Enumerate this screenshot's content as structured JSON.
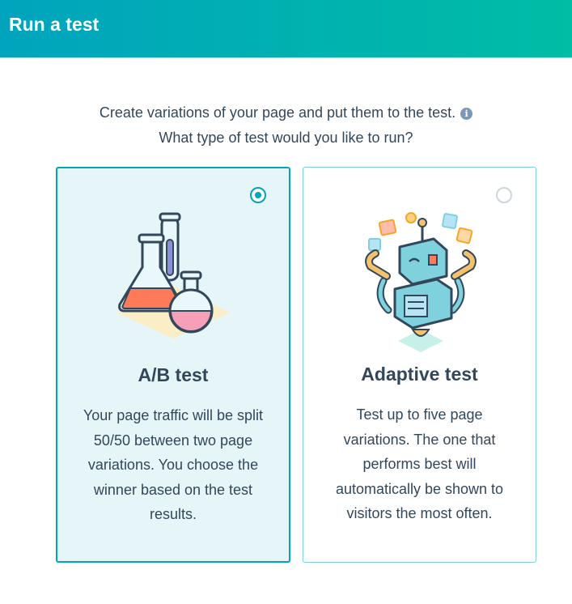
{
  "header": {
    "title": "Run a test"
  },
  "intro": {
    "line1": "Create variations of your page and put them to the test.",
    "line2": "What type of test would you like to run?",
    "info_icon": "info-icon"
  },
  "options": [
    {
      "title": "A/B test",
      "description": "Your page traffic will be split 50/50 between two page variations. You choose the winner based on the test results.",
      "selected": true,
      "illustration": "flasks-illustration"
    },
    {
      "title": "Adaptive test",
      "description": "Test up to five page variations. The one that performs best will automatically be shown to visitors the most often.",
      "selected": false,
      "illustration": "robot-illustration"
    }
  ],
  "colors": {
    "header_gradient_start": "#00a4bd",
    "header_gradient_end": "#00bda5",
    "selected_border": "#00a4bd",
    "selected_background": "#e5f5f8",
    "text": "#33475b"
  }
}
